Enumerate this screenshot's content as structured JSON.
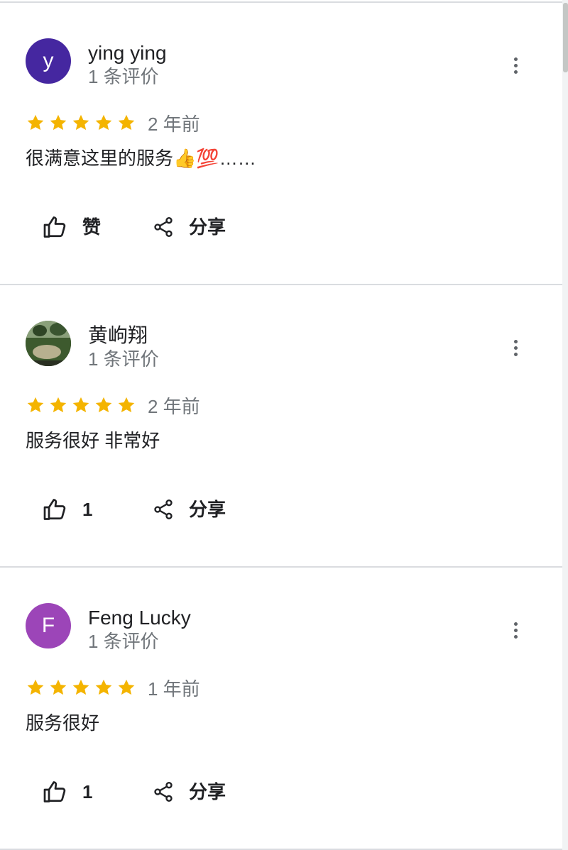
{
  "reviews": [
    {
      "avatar_letter": "y",
      "avatar_color": "#4527a0",
      "name": "ying ying",
      "review_count": "1 条评价",
      "rating": 5,
      "time": "2 年前",
      "text": "很满意这里的服务👍💯……",
      "like_label": "赞",
      "share_label": "分享"
    },
    {
      "avatar_letter": "",
      "avatar_color": "#4d6a3c",
      "name": "黄岣翔",
      "review_count": "1 条评价",
      "rating": 5,
      "time": "2 年前",
      "text": "服务很好 非常好",
      "like_label": "1",
      "share_label": "分享"
    },
    {
      "avatar_letter": "F",
      "avatar_color": "#9c45b8",
      "name": "Feng Lucky",
      "review_count": "1 条评价",
      "rating": 5,
      "time": "1 年前",
      "text": "服务很好",
      "like_label": "1",
      "share_label": "分享"
    }
  ],
  "colors": {
    "star": "#f4b400",
    "divider": "#dadce0",
    "secondary_text": "#70757a"
  }
}
